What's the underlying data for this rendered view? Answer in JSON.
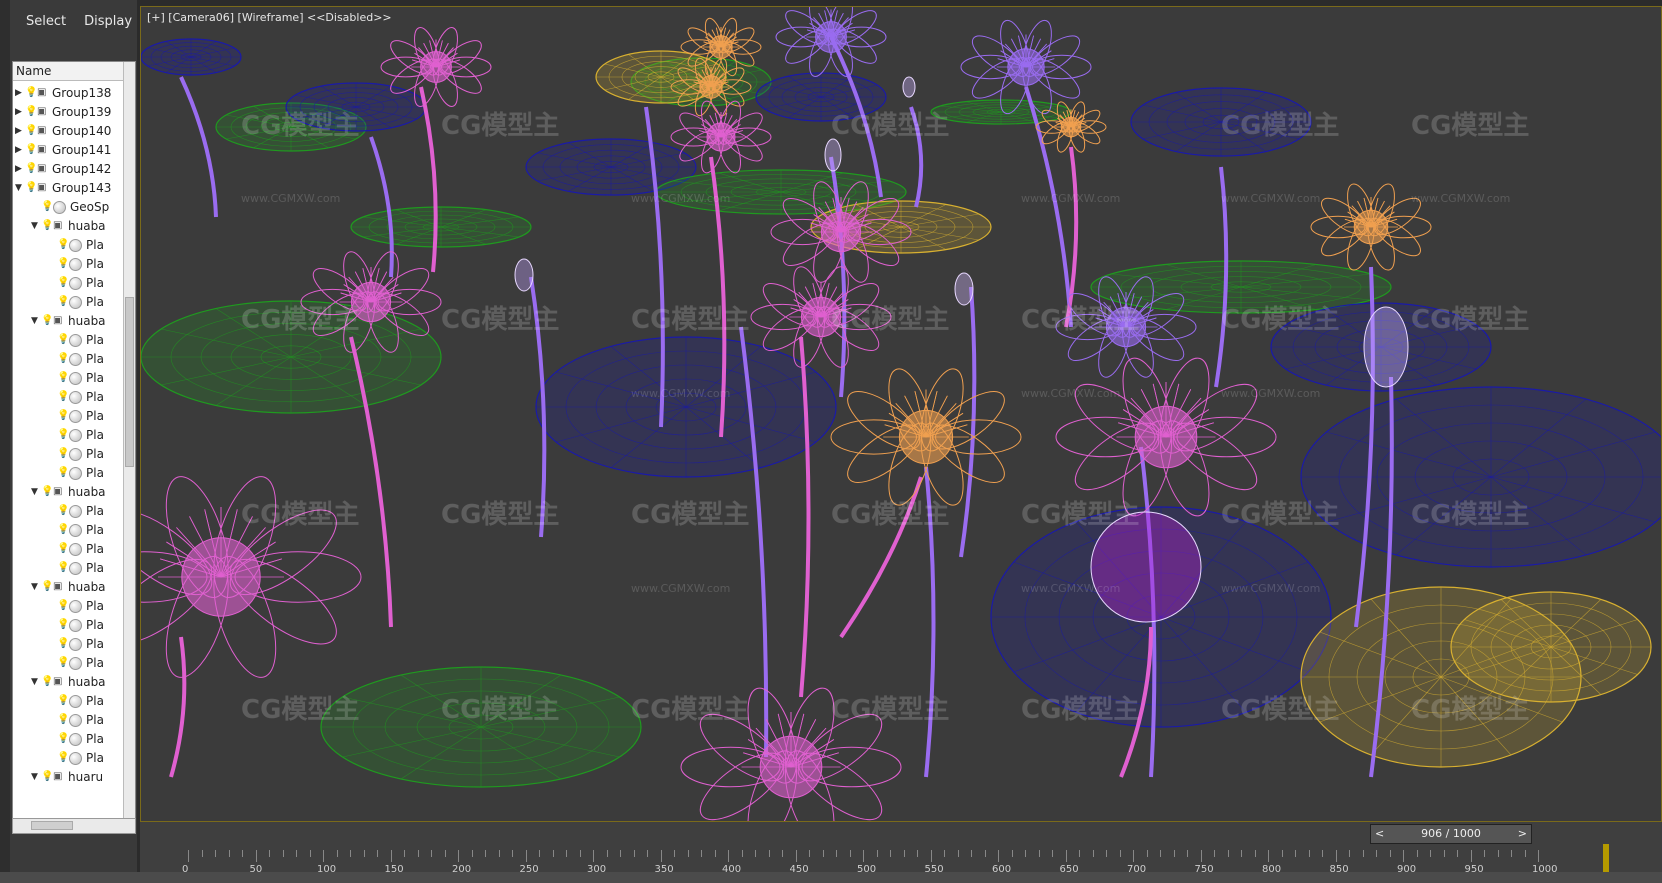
{
  "menu": {
    "select": "Select",
    "display": "Display"
  },
  "tree": {
    "header": "Name",
    "rows": [
      {
        "label": "Group138",
        "depth": 0,
        "arrow": "▶",
        "kind": "group"
      },
      {
        "label": "Group139",
        "depth": 0,
        "arrow": "▶",
        "kind": "group"
      },
      {
        "label": "Group140",
        "depth": 0,
        "arrow": "▶",
        "kind": "group"
      },
      {
        "label": "Group141",
        "depth": 0,
        "arrow": "▶",
        "kind": "group"
      },
      {
        "label": "Group142",
        "depth": 0,
        "arrow": "▶",
        "kind": "group"
      },
      {
        "label": "Group143",
        "depth": 0,
        "arrow": "▼",
        "kind": "group"
      },
      {
        "label": "GeoSp",
        "depth": 1,
        "arrow": "",
        "kind": "object"
      },
      {
        "label": "huaba",
        "depth": 1,
        "arrow": "▼",
        "kind": "group"
      },
      {
        "label": "Pla",
        "depth": 2,
        "arrow": "",
        "kind": "object"
      },
      {
        "label": "Pla",
        "depth": 2,
        "arrow": "",
        "kind": "object"
      },
      {
        "label": "Pla",
        "depth": 2,
        "arrow": "",
        "kind": "object"
      },
      {
        "label": "Pla",
        "depth": 2,
        "arrow": "",
        "kind": "object"
      },
      {
        "label": "huaba",
        "depth": 1,
        "arrow": "▼",
        "kind": "group"
      },
      {
        "label": "Pla",
        "depth": 2,
        "arrow": "",
        "kind": "object"
      },
      {
        "label": "Pla",
        "depth": 2,
        "arrow": "",
        "kind": "object"
      },
      {
        "label": "Pla",
        "depth": 2,
        "arrow": "",
        "kind": "object"
      },
      {
        "label": "Pla",
        "depth": 2,
        "arrow": "",
        "kind": "object"
      },
      {
        "label": "Pla",
        "depth": 2,
        "arrow": "",
        "kind": "object"
      },
      {
        "label": "Pla",
        "depth": 2,
        "arrow": "",
        "kind": "object"
      },
      {
        "label": "Pla",
        "depth": 2,
        "arrow": "",
        "kind": "object"
      },
      {
        "label": "Pla",
        "depth": 2,
        "arrow": "",
        "kind": "object"
      },
      {
        "label": "huaba",
        "depth": 1,
        "arrow": "▼",
        "kind": "group"
      },
      {
        "label": "Pla",
        "depth": 2,
        "arrow": "",
        "kind": "object"
      },
      {
        "label": "Pla",
        "depth": 2,
        "arrow": "",
        "kind": "object"
      },
      {
        "label": "Pla",
        "depth": 2,
        "arrow": "",
        "kind": "object"
      },
      {
        "label": "Pla",
        "depth": 2,
        "arrow": "",
        "kind": "object"
      },
      {
        "label": "huaba",
        "depth": 1,
        "arrow": "▼",
        "kind": "group"
      },
      {
        "label": "Pla",
        "depth": 2,
        "arrow": "",
        "kind": "object"
      },
      {
        "label": "Pla",
        "depth": 2,
        "arrow": "",
        "kind": "object"
      },
      {
        "label": "Pla",
        "depth": 2,
        "arrow": "",
        "kind": "object"
      },
      {
        "label": "Pla",
        "depth": 2,
        "arrow": "",
        "kind": "object"
      },
      {
        "label": "huaba",
        "depth": 1,
        "arrow": "▼",
        "kind": "group"
      },
      {
        "label": "Pla",
        "depth": 2,
        "arrow": "",
        "kind": "object"
      },
      {
        "label": "Pla",
        "depth": 2,
        "arrow": "",
        "kind": "object"
      },
      {
        "label": "Pla",
        "depth": 2,
        "arrow": "",
        "kind": "object"
      },
      {
        "label": "Pla",
        "depth": 2,
        "arrow": "",
        "kind": "object"
      },
      {
        "label": "huaru",
        "depth": 1,
        "arrow": "▼",
        "kind": "group"
      }
    ]
  },
  "viewport": {
    "label": "[+] [Camera06] [Wireframe] <<Disabled>>",
    "watermark": "CG模型主",
    "watermark_url": "www.CGMXW.com"
  },
  "timeline": {
    "slider_text": "906 / 1000",
    "prev": "<",
    "next": ">",
    "ticks": [
      "0",
      "50",
      "100",
      "150",
      "200",
      "250",
      "300",
      "350",
      "400",
      "450",
      "500",
      "550",
      "600",
      "650",
      "700",
      "750",
      "800",
      "850",
      "900",
      "950",
      "1000"
    ]
  },
  "colors": {
    "pink": "#e060d0",
    "purple": "#9a6cf0",
    "blue": "#1a1aa8",
    "green": "#1f9a1f",
    "orange": "#f0a050",
    "yellow": "#d8b030"
  }
}
